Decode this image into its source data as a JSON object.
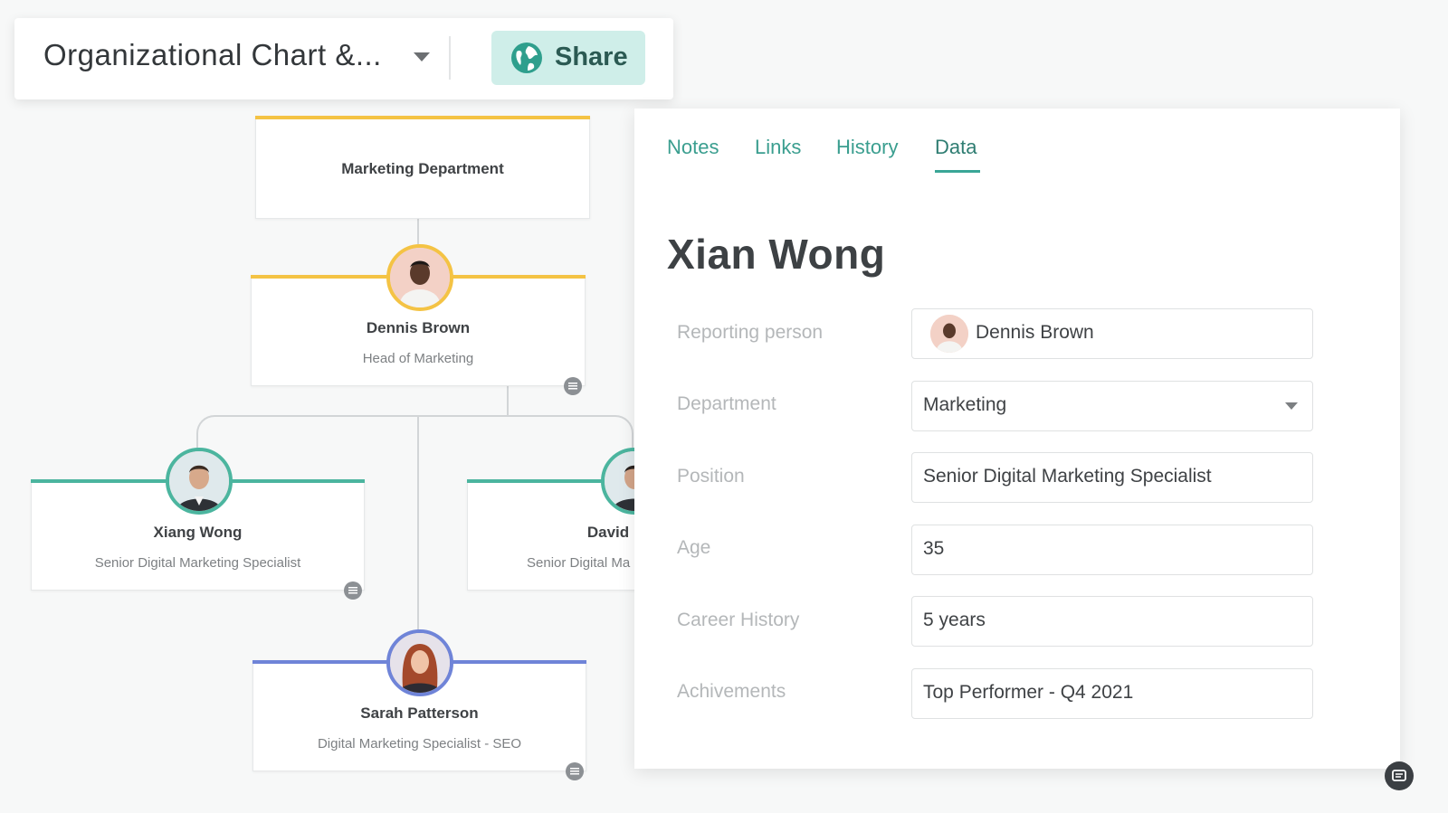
{
  "toolbar": {
    "title": "Organizational Chart &...",
    "share_label": "Share",
    "globe_icon": "globe-icon",
    "accent": "#cfeee9"
  },
  "org_chart": {
    "department": "Marketing Department",
    "head": {
      "name": "Dennis Brown",
      "role": "Head of Marketing",
      "color": "#f4c344"
    },
    "reports": [
      {
        "name": "Xiang Wong",
        "role": "Senior Digital Marketing Specialist",
        "color": "#4bb59f"
      },
      {
        "name": "David",
        "role": "Senior Digital Ma",
        "color": "#4bb59f"
      },
      {
        "name": "Sarah Patterson",
        "role": "Digital Marketing Specialist - SEO",
        "color": "#6f84d8"
      }
    ]
  },
  "panel": {
    "tabs": [
      {
        "label": "Notes"
      },
      {
        "label": "Links"
      },
      {
        "label": "History"
      },
      {
        "label": "Data"
      }
    ],
    "active_tab": "Data",
    "person_name": "Xian Wong",
    "fields": {
      "reporting_person": {
        "label": "Reporting person",
        "value": "Dennis Brown"
      },
      "department": {
        "label": "Department",
        "value": "Marketing"
      },
      "position": {
        "label": "Position",
        "value": "Senior Digital Marketing Specialist"
      },
      "age": {
        "label": "Age",
        "value": "35"
      },
      "career_history": {
        "label": "Career History",
        "value": "5 years"
      },
      "achievements": {
        "label": "Achivements",
        "value": "Top Performer - Q4 2021"
      }
    }
  }
}
